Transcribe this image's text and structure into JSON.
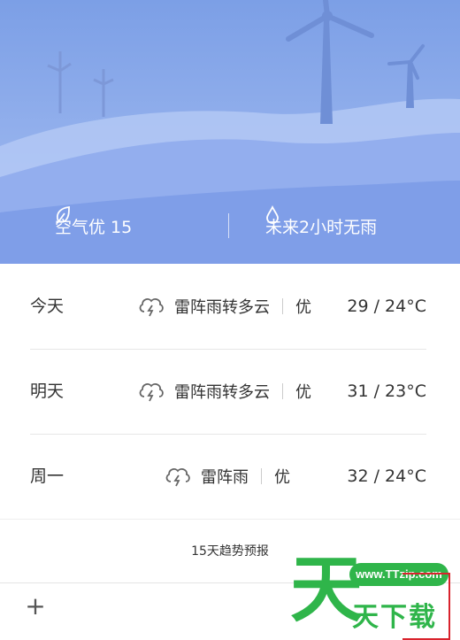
{
  "hero": {
    "air_quality": "空气优 15",
    "rain_forecast": "未来2小时无雨",
    "colors": {
      "sky_top": "#6f95e3",
      "sky_bottom": "#a9c1f3",
      "hill_back": "#b6cbf4",
      "hill_front": "#8eabee"
    }
  },
  "forecast": {
    "rows": [
      {
        "day": "今天",
        "condition": "雷阵雨转多云",
        "quality": "优",
        "temp": "29 / 24°C",
        "icon": "thunderstorm-cloud-icon"
      },
      {
        "day": "明天",
        "condition": "雷阵雨转多云",
        "quality": "优",
        "temp": "31 / 23°C",
        "icon": "thunderstorm-cloud-icon"
      },
      {
        "day": "周一",
        "condition": "雷阵雨",
        "quality": "优",
        "temp": "32 / 24°C",
        "icon": "thunderstorm-cloud-icon"
      }
    ]
  },
  "trend": {
    "label": "15天趋势预报"
  },
  "bottom": {
    "add_label": "+"
  },
  "watermark": {
    "url": "www.TTzip.com",
    "big_char": "天",
    "text": "天下载"
  }
}
